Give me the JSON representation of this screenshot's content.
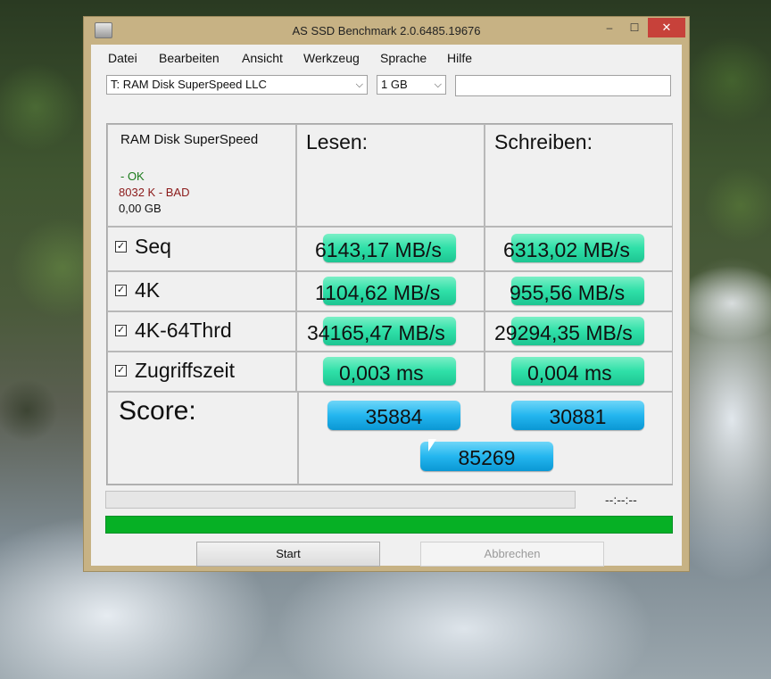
{
  "window": {
    "title": "AS SSD Benchmark 2.0.6485.19676"
  },
  "titlebar_buttons": {
    "minimize": "–",
    "maximize": "☐",
    "close": "✕"
  },
  "menu": [
    "Datei",
    "Bearbeiten",
    "Ansicht",
    "Werkzeug",
    "Sprache",
    "Hilfe"
  ],
  "drive_select": {
    "value": "T: RAM Disk SuperSpeed LLC"
  },
  "size_select": {
    "value": "1 GB"
  },
  "drive_info": {
    "name": "RAM Disk SuperSpeed",
    "status_ok": "- OK",
    "status_bad": "8032 K - BAD",
    "size": "0,00 GB"
  },
  "columns": {
    "read": "Lesen:",
    "write": "Schreiben:"
  },
  "rows": [
    {
      "label": "Seq",
      "checked": true,
      "read": "6143,17 MB/s",
      "write": "6313,02 MB/s"
    },
    {
      "label": "4K",
      "checked": true,
      "read": "1104,62 MB/s",
      "write": "955,56 MB/s"
    },
    {
      "label": "4K-64Thrd",
      "checked": true,
      "read": "34165,47 MB/s",
      "write": "29294,35 MB/s"
    },
    {
      "label": "Zugriffszeit",
      "checked": true,
      "read": "0,003 ms",
      "write": "0,004 ms"
    }
  ],
  "score": {
    "label": "Score:",
    "read": "35884",
    "write": "30881",
    "total": "85269"
  },
  "progress": {
    "elapsed": "--:--:--",
    "test_progress": 0,
    "overall_progress": 1
  },
  "buttons": {
    "start": "Start",
    "abort": "Abbrechen"
  },
  "colors": {
    "green_pill": "#2fe0a8",
    "blue_pill": "#24b6ef",
    "progress_green": "#06b025",
    "bad_text": "#8b1a1a",
    "ok_text": "#1a7a1a"
  }
}
